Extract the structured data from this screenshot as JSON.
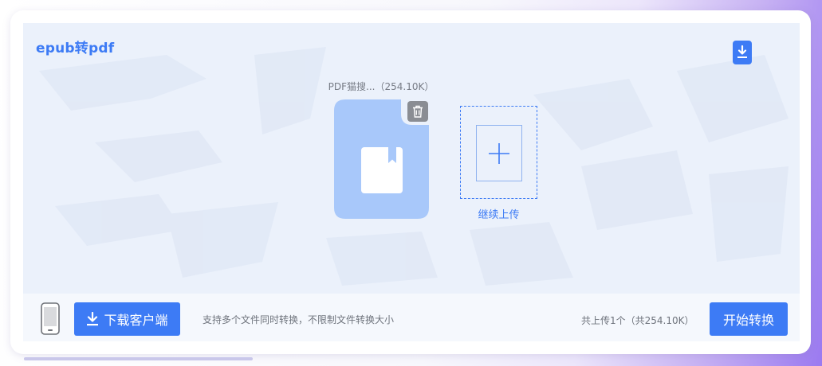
{
  "tool": {
    "title": "epub转pdf"
  },
  "file": {
    "caption": "PDF猫搜...（254.10K）",
    "color": "#a8c8fa"
  },
  "upload_more": {
    "label": "继续上传"
  },
  "bottom": {
    "download_client_label": "下载客户端",
    "support_text": "支持多个文件同时转换，不限制文件转换大小",
    "upload_count": "共上传1个（共254.10K）",
    "start_label": "开始转换"
  },
  "icons": {
    "corner": "download-icon",
    "delete": "trash-icon",
    "document": "book-icon",
    "add": "plus-icon",
    "phone": "phone-icon",
    "client": "download-icon"
  },
  "colors": {
    "accent": "#3d7bf5",
    "upload_bg": "#ebf1fb",
    "delete_bg": "#8a8d93"
  }
}
